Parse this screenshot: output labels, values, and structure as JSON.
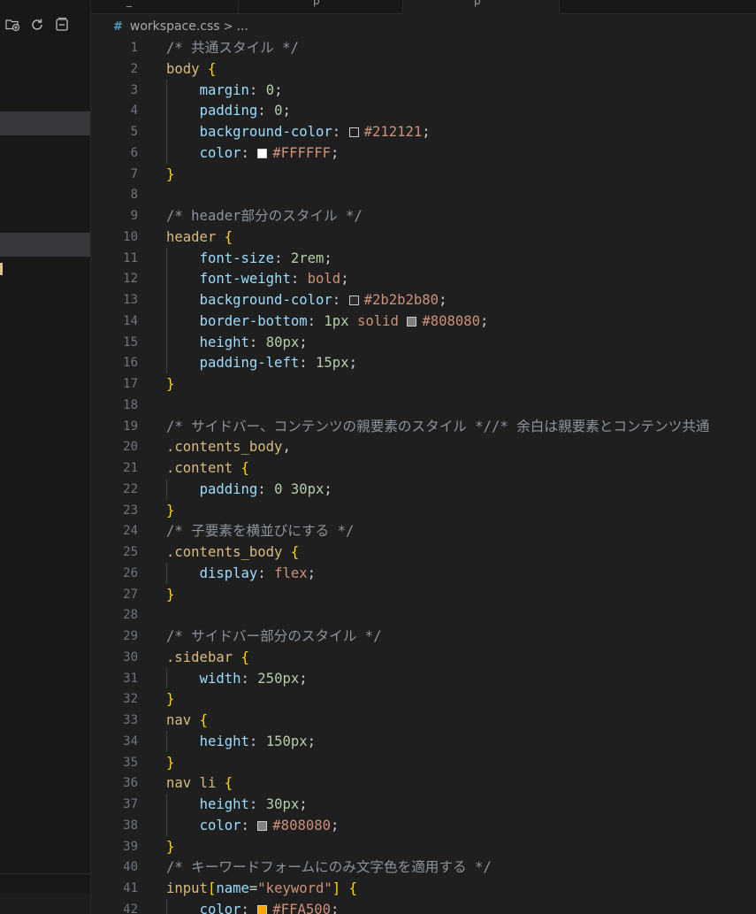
{
  "colors": {
    "editor_bg": "#1f1f1f",
    "sidebar_bg": "#181818",
    "selected_row": "#37373d",
    "swatch_212121": "#212121",
    "swatch_ffffff": "#FFFFFF",
    "swatch_2b2b2b": "#2b2b2b",
    "swatch_808080": "#808080",
    "swatch_ffa500": "#FFA500"
  },
  "sidebar": {
    "toolbar": [
      {
        "icon": "new-folder-icon"
      },
      {
        "icon": "refresh-icon"
      },
      {
        "icon": "collapse-all-icon"
      }
    ]
  },
  "tabs": [
    {
      "label": "_"
    },
    {
      "label": "p"
    },
    {
      "label": "p"
    }
  ],
  "breadcrumb": {
    "icon": "#",
    "file": "workspace.css",
    "separator": ">",
    "more": "..."
  },
  "lines": [
    {
      "n": "1",
      "tokens": [
        {
          "t": "/* 共通スタイル */",
          "c": "comment"
        }
      ]
    },
    {
      "n": "2",
      "tokens": [
        {
          "t": "body",
          "c": "sel"
        },
        {
          "t": " "
        },
        {
          "t": "{",
          "c": "brace"
        }
      ]
    },
    {
      "n": "3",
      "tokens": [
        {
          "t": "    "
        },
        {
          "t": "margin",
          "c": "prop"
        },
        {
          "t": ": "
        },
        {
          "t": "0",
          "c": "num"
        },
        {
          "t": ";"
        }
      ]
    },
    {
      "n": "4",
      "tokens": [
        {
          "t": "    "
        },
        {
          "t": "padding",
          "c": "prop"
        },
        {
          "t": ": "
        },
        {
          "t": "0",
          "c": "num"
        },
        {
          "t": ";"
        }
      ]
    },
    {
      "n": "5",
      "tokens": [
        {
          "t": "    "
        },
        {
          "t": "background-color",
          "c": "prop"
        },
        {
          "t": ": "
        },
        {
          "swatch": "#212121"
        },
        {
          "t": "#212121",
          "c": "hex"
        },
        {
          "t": ";"
        }
      ]
    },
    {
      "n": "6",
      "tokens": [
        {
          "t": "    "
        },
        {
          "t": "color",
          "c": "prop"
        },
        {
          "t": ": "
        },
        {
          "swatch": "#FFFFFF"
        },
        {
          "t": "#FFFFFF",
          "c": "hex"
        },
        {
          "t": ";"
        }
      ]
    },
    {
      "n": "7",
      "tokens": [
        {
          "t": "}",
          "c": "brace"
        }
      ]
    },
    {
      "n": "8",
      "tokens": []
    },
    {
      "n": "9",
      "tokens": [
        {
          "t": "/* header部分のスタイル */",
          "c": "comment"
        }
      ]
    },
    {
      "n": "10",
      "tokens": [
        {
          "t": "header",
          "c": "sel"
        },
        {
          "t": " "
        },
        {
          "t": "{",
          "c": "brace"
        }
      ]
    },
    {
      "n": "11",
      "tokens": [
        {
          "t": "    "
        },
        {
          "t": "font-size",
          "c": "prop"
        },
        {
          "t": ": "
        },
        {
          "t": "2rem",
          "c": "num"
        },
        {
          "t": ";"
        }
      ]
    },
    {
      "n": "12",
      "tokens": [
        {
          "t": "    "
        },
        {
          "t": "font-weight",
          "c": "prop"
        },
        {
          "t": ": "
        },
        {
          "t": "bold",
          "c": "val"
        },
        {
          "t": ";"
        }
      ]
    },
    {
      "n": "13",
      "tokens": [
        {
          "t": "    "
        },
        {
          "t": "background-color",
          "c": "prop"
        },
        {
          "t": ": "
        },
        {
          "swatch": "#2b2b2b"
        },
        {
          "t": "#2b2b2b80",
          "c": "hex"
        },
        {
          "t": ";"
        }
      ]
    },
    {
      "n": "14",
      "tokens": [
        {
          "t": "    "
        },
        {
          "t": "border-bottom",
          "c": "prop"
        },
        {
          "t": ": "
        },
        {
          "t": "1px",
          "c": "num"
        },
        {
          "t": " "
        },
        {
          "t": "solid",
          "c": "val"
        },
        {
          "t": " "
        },
        {
          "swatch": "#808080"
        },
        {
          "t": "#808080",
          "c": "hex"
        },
        {
          "t": ";"
        }
      ]
    },
    {
      "n": "15",
      "tokens": [
        {
          "t": "    "
        },
        {
          "t": "height",
          "c": "prop"
        },
        {
          "t": ": "
        },
        {
          "t": "80px",
          "c": "num"
        },
        {
          "t": ";"
        }
      ]
    },
    {
      "n": "16",
      "tokens": [
        {
          "t": "    "
        },
        {
          "t": "padding-left",
          "c": "prop"
        },
        {
          "t": ": "
        },
        {
          "t": "15px",
          "c": "num"
        },
        {
          "t": ";"
        }
      ]
    },
    {
      "n": "17",
      "tokens": [
        {
          "t": "}",
          "c": "brace"
        }
      ]
    },
    {
      "n": "18",
      "tokens": []
    },
    {
      "n": "19",
      "tokens": [
        {
          "t": "/* サイドバー、コンテンツの親要素のスタイル *//* 余白は親要素とコンテンツ共通",
          "c": "comment"
        }
      ]
    },
    {
      "n": "20",
      "tokens": [
        {
          "t": ".contents_body",
          "c": "sel"
        },
        {
          "t": ","
        }
      ]
    },
    {
      "n": "21",
      "tokens": [
        {
          "t": ".content",
          "c": "sel"
        },
        {
          "t": " "
        },
        {
          "t": "{",
          "c": "brace"
        }
      ]
    },
    {
      "n": "22",
      "tokens": [
        {
          "t": "    "
        },
        {
          "t": "padding",
          "c": "prop"
        },
        {
          "t": ": "
        },
        {
          "t": "0",
          "c": "num"
        },
        {
          "t": " "
        },
        {
          "t": "30px",
          "c": "num"
        },
        {
          "t": ";"
        }
      ]
    },
    {
      "n": "23",
      "tokens": [
        {
          "t": "}",
          "c": "brace"
        }
      ]
    },
    {
      "n": "24",
      "tokens": [
        {
          "t": "/* 子要素を横並びにする */",
          "c": "comment"
        }
      ]
    },
    {
      "n": "25",
      "tokens": [
        {
          "t": ".contents_body",
          "c": "sel"
        },
        {
          "t": " "
        },
        {
          "t": "{",
          "c": "brace"
        }
      ]
    },
    {
      "n": "26",
      "tokens": [
        {
          "t": "    "
        },
        {
          "t": "display",
          "c": "prop"
        },
        {
          "t": ": "
        },
        {
          "t": "flex",
          "c": "val"
        },
        {
          "t": ";"
        }
      ]
    },
    {
      "n": "27",
      "tokens": [
        {
          "t": "}",
          "c": "brace"
        }
      ]
    },
    {
      "n": "28",
      "tokens": []
    },
    {
      "n": "29",
      "tokens": [
        {
          "t": "/* サイドバー部分のスタイル */",
          "c": "comment"
        }
      ]
    },
    {
      "n": "30",
      "tokens": [
        {
          "t": ".sidebar",
          "c": "sel"
        },
        {
          "t": " "
        },
        {
          "t": "{",
          "c": "brace"
        }
      ]
    },
    {
      "n": "31",
      "tokens": [
        {
          "t": "    "
        },
        {
          "t": "width",
          "c": "prop"
        },
        {
          "t": ": "
        },
        {
          "t": "250px",
          "c": "num"
        },
        {
          "t": ";"
        }
      ]
    },
    {
      "n": "32",
      "tokens": [
        {
          "t": "}",
          "c": "brace"
        }
      ]
    },
    {
      "n": "33",
      "tokens": [
        {
          "t": "nav",
          "c": "sel"
        },
        {
          "t": " "
        },
        {
          "t": "{",
          "c": "brace"
        }
      ]
    },
    {
      "n": "34",
      "tokens": [
        {
          "t": "    "
        },
        {
          "t": "height",
          "c": "prop"
        },
        {
          "t": ": "
        },
        {
          "t": "150px",
          "c": "num"
        },
        {
          "t": ";"
        }
      ]
    },
    {
      "n": "35",
      "tokens": [
        {
          "t": "}",
          "c": "brace"
        }
      ]
    },
    {
      "n": "36",
      "tokens": [
        {
          "t": "nav li",
          "c": "sel"
        },
        {
          "t": " "
        },
        {
          "t": "{",
          "c": "brace"
        }
      ]
    },
    {
      "n": "37",
      "tokens": [
        {
          "t": "    "
        },
        {
          "t": "height",
          "c": "prop"
        },
        {
          "t": ": "
        },
        {
          "t": "30px",
          "c": "num"
        },
        {
          "t": ";"
        }
      ]
    },
    {
      "n": "38",
      "tokens": [
        {
          "t": "    "
        },
        {
          "t": "color",
          "c": "prop"
        },
        {
          "t": ": "
        },
        {
          "swatch": "#808080"
        },
        {
          "t": "#808080",
          "c": "hex"
        },
        {
          "t": ";"
        }
      ]
    },
    {
      "n": "39",
      "tokens": [
        {
          "t": "}",
          "c": "brace"
        }
      ]
    },
    {
      "n": "40",
      "tokens": [
        {
          "t": "/* キーワードフォームにのみ文字色を適用する */",
          "c": "comment"
        }
      ]
    },
    {
      "n": "41",
      "tokens": [
        {
          "t": "input",
          "c": "sel"
        },
        {
          "t": "[",
          "c": "brace"
        },
        {
          "t": "name",
          "c": "attr"
        },
        {
          "t": "="
        },
        {
          "t": "\"keyword\"",
          "c": "str"
        },
        {
          "t": "]",
          "c": "brace"
        },
        {
          "t": " "
        },
        {
          "t": "{",
          "c": "brace"
        }
      ]
    },
    {
      "n": "42",
      "tokens": [
        {
          "t": "    "
        },
        {
          "t": "color",
          "c": "prop"
        },
        {
          "t": ": "
        },
        {
          "swatch": "#FFA500"
        },
        {
          "t": "#FFA500",
          "c": "hex"
        },
        {
          "t": ";"
        }
      ]
    }
  ]
}
